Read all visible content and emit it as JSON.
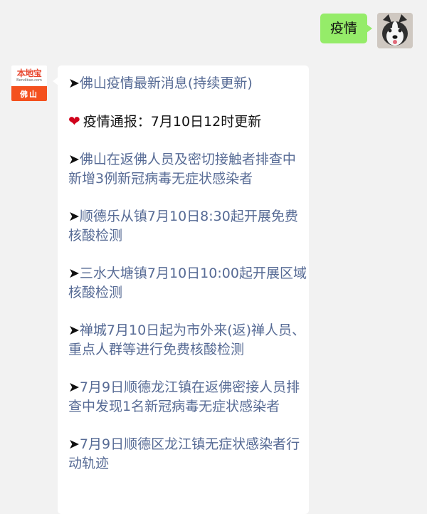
{
  "outgoing": {
    "text": "疫情"
  },
  "incoming": {
    "bot_avatar": {
      "logo": "本地宝",
      "url": "Bendibao.com",
      "city": "佛山"
    },
    "links_top": "佛山疫情最新消息(持续更新)",
    "notice": "疫情通报：7月10日12时更新",
    "heart_icon": "heart-icon",
    "arrow_icon": "➤",
    "links": [
      "佛山在返佛人员及密切接触者排查中新增3例新冠病毒无症状感染者",
      "顺德乐从镇7月10日8:30起开展免费核酸检测",
      "三水大塘镇7月10日10:00起开展区域核酸检测",
      "禅城7月10日起为市外来(返)禅人员、重点人群等进行免费核酸检测",
      "7月9日顺德龙江镇在返佛密接人员排查中发现1名新冠病毒无症状感染者",
      "7月9日顺德区龙江镇无症状感染者行动轨迹"
    ]
  },
  "colors": {
    "background": "#f2f2f2",
    "outgoing_bubble": "#95ec69",
    "link": "#576b95",
    "bot_brand": "#f4511e"
  }
}
